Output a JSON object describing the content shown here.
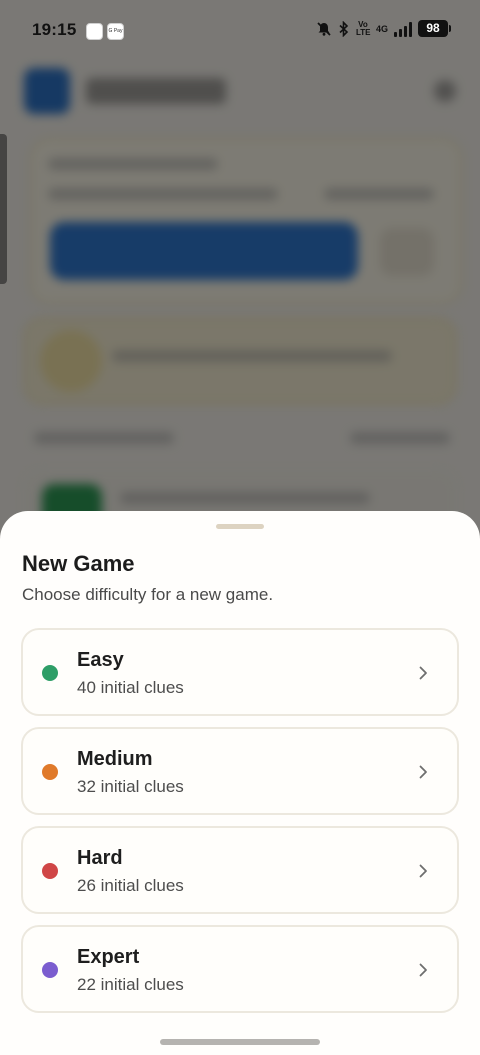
{
  "status_bar": {
    "time": "19:15",
    "battery": "98",
    "network": "4G",
    "volte": "Vo LTE",
    "app_icons": [
      "app-notification-icon",
      "g-pay-icon"
    ],
    "app_icon_texts": [
      "",
      "G Pay"
    ],
    "icons": [
      "mute-bell-icon",
      "bluetooth-icon",
      "volte-icon",
      "signal-icon",
      "battery-icon"
    ]
  },
  "sheet": {
    "title": "New Game",
    "subtitle": "Choose difficulty for a new game.",
    "options": [
      {
        "label": "Easy",
        "desc": "40 initial clues",
        "color": "#2e9e67"
      },
      {
        "label": "Medium",
        "desc": "32 initial clues",
        "color": "#e07a2a"
      },
      {
        "label": "Hard",
        "desc": "26 initial clues",
        "color": "#d04646"
      },
      {
        "label": "Expert",
        "desc": "22 initial clues",
        "color": "#7b5dcf"
      }
    ]
  },
  "colors": {
    "sheet_background": "#fffefc",
    "option_border": "#ece8de",
    "scrim": "rgba(0,0,0,0.5)"
  }
}
